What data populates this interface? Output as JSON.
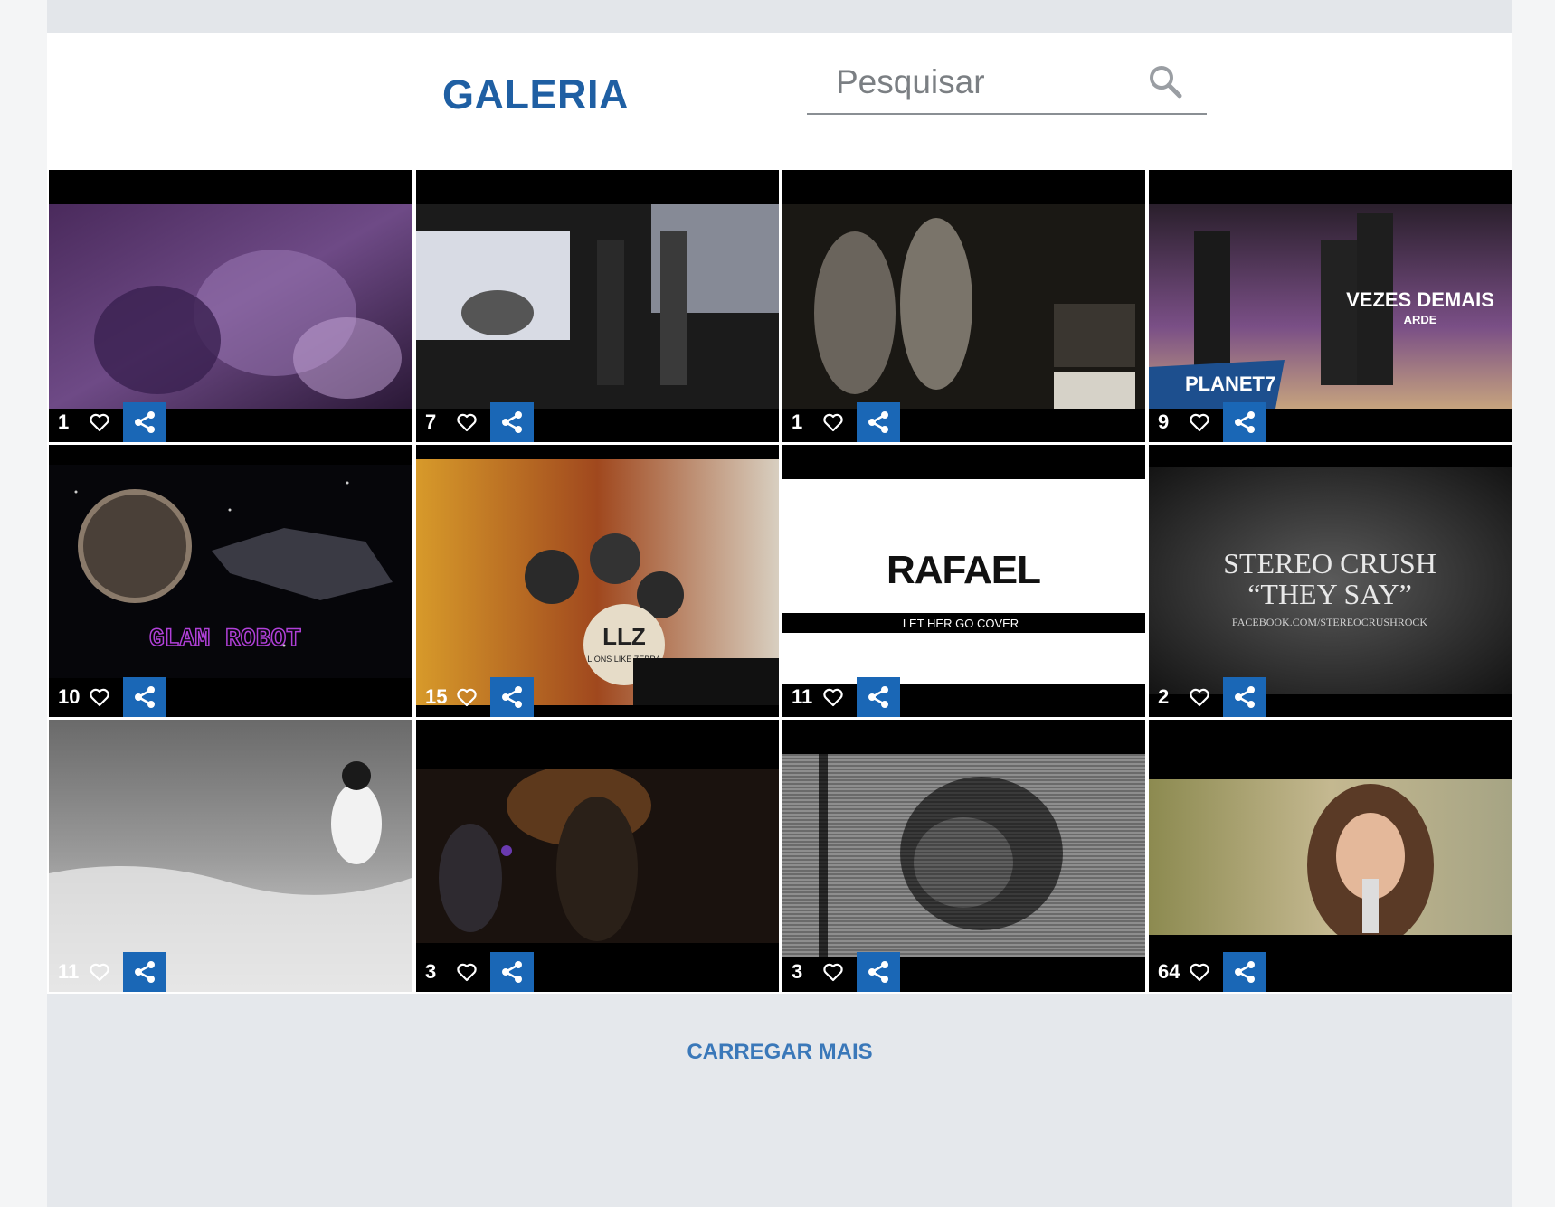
{
  "header": {
    "title": "GALERIA",
    "search_placeholder": "Pesquisar",
    "search_icon": "search-icon"
  },
  "gallery": {
    "items": [
      {
        "likes": "1"
      },
      {
        "likes": "7"
      },
      {
        "likes": "1"
      },
      {
        "likes": "9",
        "texts": [
          "VEZES DEMAIS",
          "ARDE",
          "PLANET7"
        ]
      },
      {
        "likes": "10",
        "texts": [
          "GLAM ROBOT"
        ]
      },
      {
        "likes": "15",
        "texts": [
          "LLZ",
          "LIONS LIKE ZEBRA"
        ]
      },
      {
        "likes": "11",
        "texts": [
          "RAFAEL",
          "LET HER GO COVER"
        ]
      },
      {
        "likes": "2",
        "texts": [
          "STEREO CRUSH",
          "“THEY SAY”",
          "FACEBOOK.COM/STEREOCRUSHROCK"
        ]
      },
      {
        "likes": "11"
      },
      {
        "likes": "3"
      },
      {
        "likes": "3"
      },
      {
        "likes": "64"
      }
    ]
  },
  "footer": {
    "load_more": "CARREGAR MAIS"
  },
  "colors": {
    "brand_blue": "#1f5fa3",
    "share_blue": "#1a67b6",
    "link_blue": "#3a78b9"
  }
}
